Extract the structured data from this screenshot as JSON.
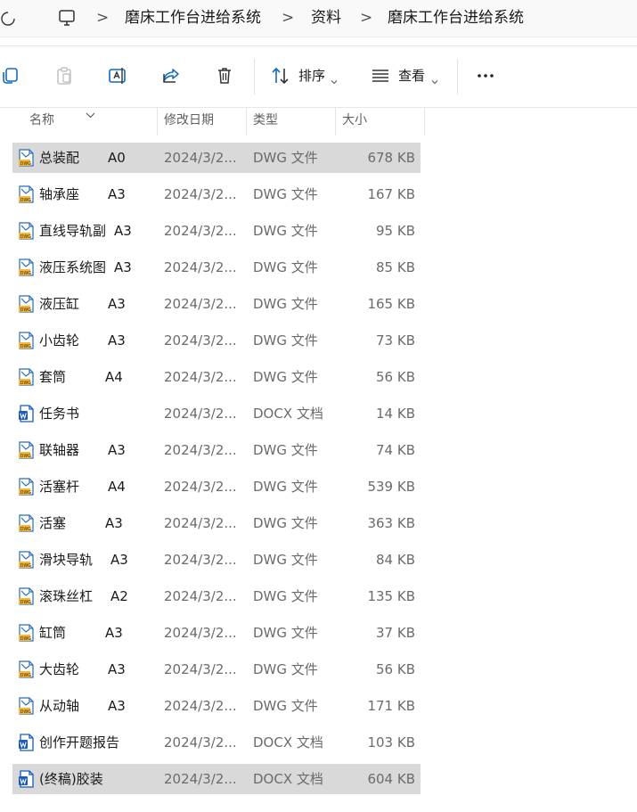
{
  "breadcrumb": {
    "items": [
      "磨床工作台进给系统",
      "资料",
      "磨床工作台进给系统"
    ],
    "separator": ">"
  },
  "toolbar": {
    "sort_label": "排序",
    "view_label": "查看",
    "more_label": "..."
  },
  "columns": {
    "name": "名称",
    "modified": "修改日期",
    "type": "类型",
    "size": "大小"
  },
  "colors": {
    "selected_row": "#d9d9d9",
    "dwg_icon": "#f5b83d",
    "docx_icon": "#185abd"
  },
  "files": [
    {
      "name": "总装配",
      "tag": "A0",
      "date": "2024/3/2...",
      "type": "DWG 文件",
      "size": "678 KB",
      "icon": "dwg-file-icon",
      "selected": true
    },
    {
      "name": "轴承座",
      "tag": "A3",
      "date": "2024/3/2...",
      "type": "DWG 文件",
      "size": "167 KB",
      "icon": "dwg-file-icon",
      "selected": false
    },
    {
      "name": "直线导轨副",
      "tag": "A3",
      "date": "2024/3/2...",
      "type": "DWG 文件",
      "size": "95 KB",
      "icon": "dwg-file-icon",
      "selected": false
    },
    {
      "name": "液压系统图",
      "tag": "A3",
      "date": "2024/3/2...",
      "type": "DWG 文件",
      "size": "85 KB",
      "icon": "dwg-file-icon",
      "selected": false
    },
    {
      "name": "液压缸",
      "tag": "A3",
      "date": "2024/3/2...",
      "type": "DWG 文件",
      "size": "165 KB",
      "icon": "dwg-file-icon",
      "selected": false
    },
    {
      "name": "小齿轮",
      "tag": "A3",
      "date": "2024/3/2...",
      "type": "DWG 文件",
      "size": "73 KB",
      "icon": "dwg-file-icon",
      "selected": false
    },
    {
      "name": "套筒",
      "tag": "A4",
      "date": "2024/3/2...",
      "type": "DWG 文件",
      "size": "56 KB",
      "icon": "dwg-file-icon",
      "selected": false
    },
    {
      "name": "任务书",
      "tag": "",
      "date": "2024/3/2...",
      "type": "DOCX 文档",
      "size": "14 KB",
      "icon": "word-file-icon",
      "selected": false
    },
    {
      "name": "联轴器",
      "tag": "A3",
      "date": "2024/3/2...",
      "type": "DWG 文件",
      "size": "74 KB",
      "icon": "dwg-file-icon",
      "selected": false
    },
    {
      "name": "活塞杆",
      "tag": "A4",
      "date": "2024/3/2...",
      "type": "DWG 文件",
      "size": "539 KB",
      "icon": "dwg-file-icon",
      "selected": false
    },
    {
      "name": "活塞",
      "tag": "A3",
      "date": "2024/3/2...",
      "type": "DWG 文件",
      "size": "363 KB",
      "icon": "dwg-file-icon",
      "selected": false
    },
    {
      "name": "滑块导轨",
      "tag": "A3",
      "date": "2024/3/2...",
      "type": "DWG 文件",
      "size": "84 KB",
      "icon": "dwg-file-icon",
      "selected": false
    },
    {
      "name": "滚珠丝杠",
      "tag": "A2",
      "date": "2024/3/2...",
      "type": "DWG 文件",
      "size": "135 KB",
      "icon": "dwg-file-icon",
      "selected": false
    },
    {
      "name": "缸筒",
      "tag": "A3",
      "date": "2024/3/2...",
      "type": "DWG 文件",
      "size": "37 KB",
      "icon": "dwg-file-icon",
      "selected": false
    },
    {
      "name": "大齿轮",
      "tag": "A3",
      "date": "2024/3/2...",
      "type": "DWG 文件",
      "size": "56 KB",
      "icon": "dwg-file-icon",
      "selected": false
    },
    {
      "name": "从动轴",
      "tag": "A3",
      "date": "2024/3/2...",
      "type": "DWG 文件",
      "size": "171 KB",
      "icon": "dwg-file-icon",
      "selected": false
    },
    {
      "name": "创作开题报告",
      "tag": "",
      "date": "2024/3/2...",
      "type": "DOCX 文档",
      "size": "103 KB",
      "icon": "word-file-icon",
      "selected": false
    },
    {
      "name": "(终稿)胶装",
      "tag": "",
      "date": "2024/3/2...",
      "type": "DOCX 文档",
      "size": "604 KB",
      "icon": "word-file-icon",
      "selected": true
    }
  ]
}
